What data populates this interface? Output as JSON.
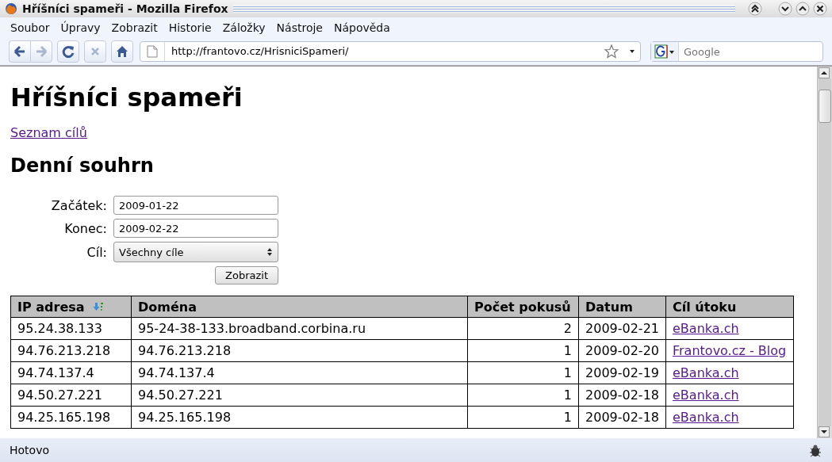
{
  "window": {
    "title": "Hříšníci spameři - Mozilla Firefox"
  },
  "menu": [
    {
      "label": "Soubor"
    },
    {
      "label": "Úpravy"
    },
    {
      "label": "Zobrazit"
    },
    {
      "label": "Historie"
    },
    {
      "label": "Záložky"
    },
    {
      "label": "Nástroje"
    },
    {
      "label": "Nápověda"
    }
  ],
  "toolbar": {
    "buttons": [
      {
        "kind": "back",
        "disabled": false
      },
      {
        "kind": "forward",
        "disabled": true
      },
      {
        "kind": "reload",
        "disabled": false
      },
      {
        "kind": "stop",
        "disabled": true
      },
      {
        "kind": "home",
        "disabled": false
      }
    ],
    "url": "http://frantovo.cz/HrisniciSpameri/",
    "search_placeholder": "Google"
  },
  "page": {
    "heading": "Hříšníci spameři",
    "link": "Seznam cílů",
    "subheading": "Denní souhrn",
    "form": [
      {
        "kind": "text",
        "label": "Začátek:",
        "value": "2009-01-22"
      },
      {
        "kind": "text",
        "label": "Konec:",
        "value": "2009-02-22"
      },
      {
        "kind": "select",
        "label": "Cíl:",
        "value": "Všechny cíle"
      }
    ],
    "submit": "Zobrazit",
    "table": {
      "columns": [
        {
          "label": "IP adresa",
          "sorted": true
        },
        {
          "label": "Doména",
          "sorted": false
        },
        {
          "label": "Počet pokusů",
          "sorted": false
        },
        {
          "label": "Datum",
          "sorted": false
        },
        {
          "label": "Cíl útoku",
          "sorted": false
        }
      ],
      "rows": [
        [
          "95.24.38.133",
          "95-24-38-133.broadband.corbina.ru",
          "2",
          "2009-02-21",
          "eBanka.ch"
        ],
        [
          "94.76.213.218",
          "94.76.213.218",
          "1",
          "2009-02-20",
          "Frantovo.cz - Blog"
        ],
        [
          "94.74.137.4",
          "94.74.137.4",
          "1",
          "2009-02-19",
          "eBanka.ch"
        ],
        [
          "94.50.27.221",
          "94.50.27.221",
          "1",
          "2009-02-18",
          "eBanka.ch"
        ],
        [
          "94.25.165.198",
          "94.25.165.198",
          "1",
          "2009-02-18",
          "eBanka.ch"
        ]
      ]
    }
  },
  "status_bar": "Hotovo"
}
